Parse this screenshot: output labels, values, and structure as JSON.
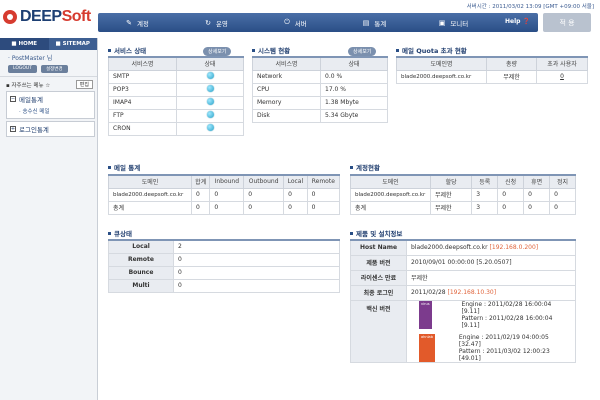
{
  "logo": {
    "text_a": "DEEP",
    "text_b": "Soft"
  },
  "server_time": "서버시간 : 2011/03/02 13:09 [GMT +09:00 서울]",
  "nav": [
    {
      "label": "계정",
      "icon": "user-icon"
    },
    {
      "label": "운영",
      "icon": "refresh-icon"
    },
    {
      "label": "서버",
      "icon": "power-icon"
    },
    {
      "label": "통계",
      "icon": "chart-icon"
    },
    {
      "label": "모니터",
      "icon": "monitor-icon"
    }
  ],
  "help_label": "Help",
  "apply_label": "적 용",
  "sidebar": {
    "home": "HOME",
    "sitemap": "SITEMAP",
    "user": "PostMaster 님",
    "logout": "LOGOUT",
    "settings": "설정변경",
    "fav_label": "자주쓰는 메뉴",
    "fav_edit": "편집",
    "group1": "메일통계",
    "group1_sub": "송수신 메일",
    "group2": "로그인통계"
  },
  "service": {
    "title": "서비스 상태",
    "detail": "상세보기",
    "headers": [
      "서비스명",
      "상태"
    ],
    "rows": [
      "SMTP",
      "POP3",
      "IMAP4",
      "FTP",
      "CRON"
    ]
  },
  "system": {
    "title": "시스템 현황",
    "detail": "상세보기",
    "headers": [
      "서비스명",
      "상태"
    ],
    "rows": [
      [
        "Network",
        "0.0 %"
      ],
      [
        "CPU",
        "17.0 %"
      ],
      [
        "Memory",
        "1.38 Mbyte"
      ],
      [
        "Disk",
        "5.34 Gbyte"
      ]
    ]
  },
  "quota": {
    "title": "메일 Quota 초과 현황",
    "headers": [
      "도메인명",
      "총량",
      "초과 사용자"
    ],
    "rows": [
      [
        "blade2000.deepsoft.co.kr",
        "무제한",
        "0"
      ]
    ]
  },
  "mail_stats": {
    "title": "메일 통계",
    "headers": [
      "도메인",
      "합계",
      "Inbound",
      "Outbound",
      "Local",
      "Remote"
    ],
    "rows": [
      [
        "blade2000.deepsoft.co.kr",
        "0",
        "0",
        "0",
        "0",
        "0"
      ],
      [
        "총계",
        "0",
        "0",
        "0",
        "0",
        "0"
      ]
    ]
  },
  "account": {
    "title": "계정현황",
    "headers": [
      "도메인",
      "할당",
      "등록",
      "신청",
      "휴면",
      "정지"
    ],
    "rows": [
      [
        "blade2000.deepsoft.co.kr",
        "무제한",
        "3",
        "0",
        "0",
        "0"
      ],
      [
        "총계",
        "무제한",
        "3",
        "0",
        "0",
        "0"
      ]
    ]
  },
  "queue": {
    "title": "큐상태",
    "rows": [
      [
        "Local",
        "2"
      ],
      [
        "Remote",
        "0"
      ],
      [
        "Bounce",
        "0"
      ],
      [
        "Multi",
        "0"
      ]
    ]
  },
  "product": {
    "title": "제품 및 설치정보",
    "host_label": "Host Name",
    "host": "blade2000.deepsoft.co.kr",
    "host_ip": "[192.168.0.200]",
    "ver_label": "제품 버전",
    "ver": "2010/09/01 00:00:00 [5.20.0507]",
    "lic_label": "라이센스 만료",
    "lic": "무제한",
    "login_label": "최종 로그인",
    "login": "2011/02/28",
    "login_ip": "[192.168.10.30]",
    "vac_label": "백신 버전",
    "vac1_badge": "virus",
    "vac1_engine": "Engine : 2011/02/28 16:00:04 [9.11]",
    "vac1_pattern": "Pattern : 2011/02/28 16:00:04 [9.11]",
    "vac2_badge": "ahnlab",
    "vac2_engine": "Engine : 2011/02/19 04:00:05 [32.47]",
    "vac2_pattern": "Pattern : 2011/03/02 12:00:23 [49.01]"
  },
  "colors": {
    "nav": "#2a4e86",
    "accent": "#e0653c",
    "status_dot": "#2ba3c8"
  }
}
